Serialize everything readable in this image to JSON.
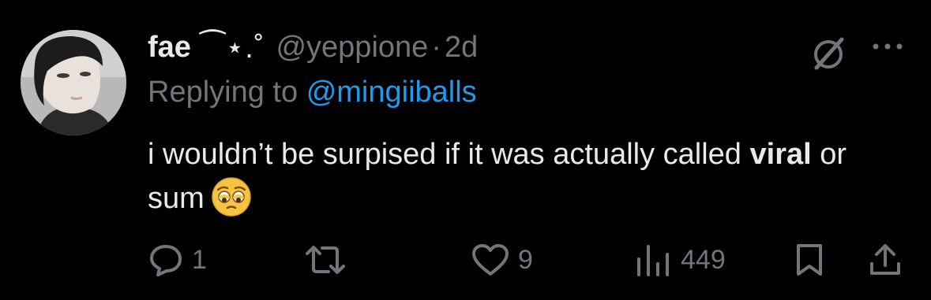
{
  "tweet": {
    "display_name": "fae",
    "name_decoration": "⁀⋆.˚",
    "handle": "@yeppione",
    "separator": "·",
    "timestamp": "2d",
    "replying_prefix": "Replying to",
    "replying_to": "@mingiiballs",
    "text_part1": "i wouldn’t be surpised if it was actually called ",
    "text_bold": "viral",
    "text_part2": " or sum",
    "emoji": "pleading-face-emoji"
  },
  "actions": {
    "reply_count": "1",
    "retweet_count": "",
    "like_count": "9",
    "views_count": "449"
  },
  "colors": {
    "background": "#000000",
    "text": "#e7e9ea",
    "secondary": "#71767b",
    "link": "#1d9bf0"
  },
  "icons": [
    "grok-icon",
    "more-icon",
    "reply-icon",
    "retweet-icon",
    "like-icon",
    "views-icon",
    "bookmark-icon",
    "share-icon"
  ]
}
